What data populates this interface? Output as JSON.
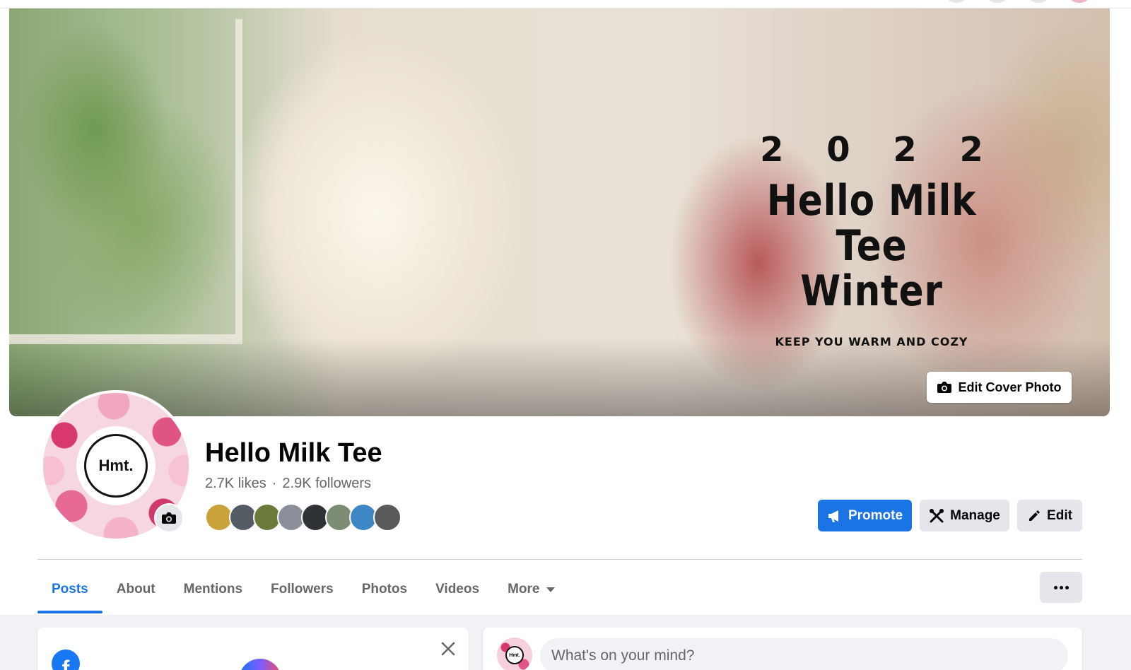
{
  "cover": {
    "year": "2 0 2 2",
    "title_line1": "Hello Milk Tee",
    "title_line2": "Winter",
    "subtitle": "KEEP YOU WARM AND COZY",
    "edit_label": "Edit Cover Photo"
  },
  "profile": {
    "avatar_text": "Hmt.",
    "name": "Hello Milk Tee",
    "likes": "2.7K likes",
    "separator": "·",
    "followers": "2.9K followers",
    "follower_faces": [
      "#c9a23a",
      "#555b63",
      "#6b7a3a",
      "#8a8f99",
      "#2f3338",
      "#7d8c74",
      "#3f86c4",
      "#5a5a5a"
    ]
  },
  "actions": {
    "promote": "Promote",
    "manage": "Manage",
    "edit": "Edit"
  },
  "tabs": [
    {
      "label": "Posts",
      "active": true
    },
    {
      "label": "About"
    },
    {
      "label": "Mentions"
    },
    {
      "label": "Followers"
    },
    {
      "label": "Photos"
    },
    {
      "label": "Videos"
    },
    {
      "label": "More"
    }
  ],
  "composer": {
    "placeholder": "What's on your mind?",
    "avatar_text": "Hmt."
  },
  "colors": {
    "accent": "#1b74e4",
    "button_gray": "#e4e6eb",
    "feed_bg": "#f0f2f5"
  }
}
